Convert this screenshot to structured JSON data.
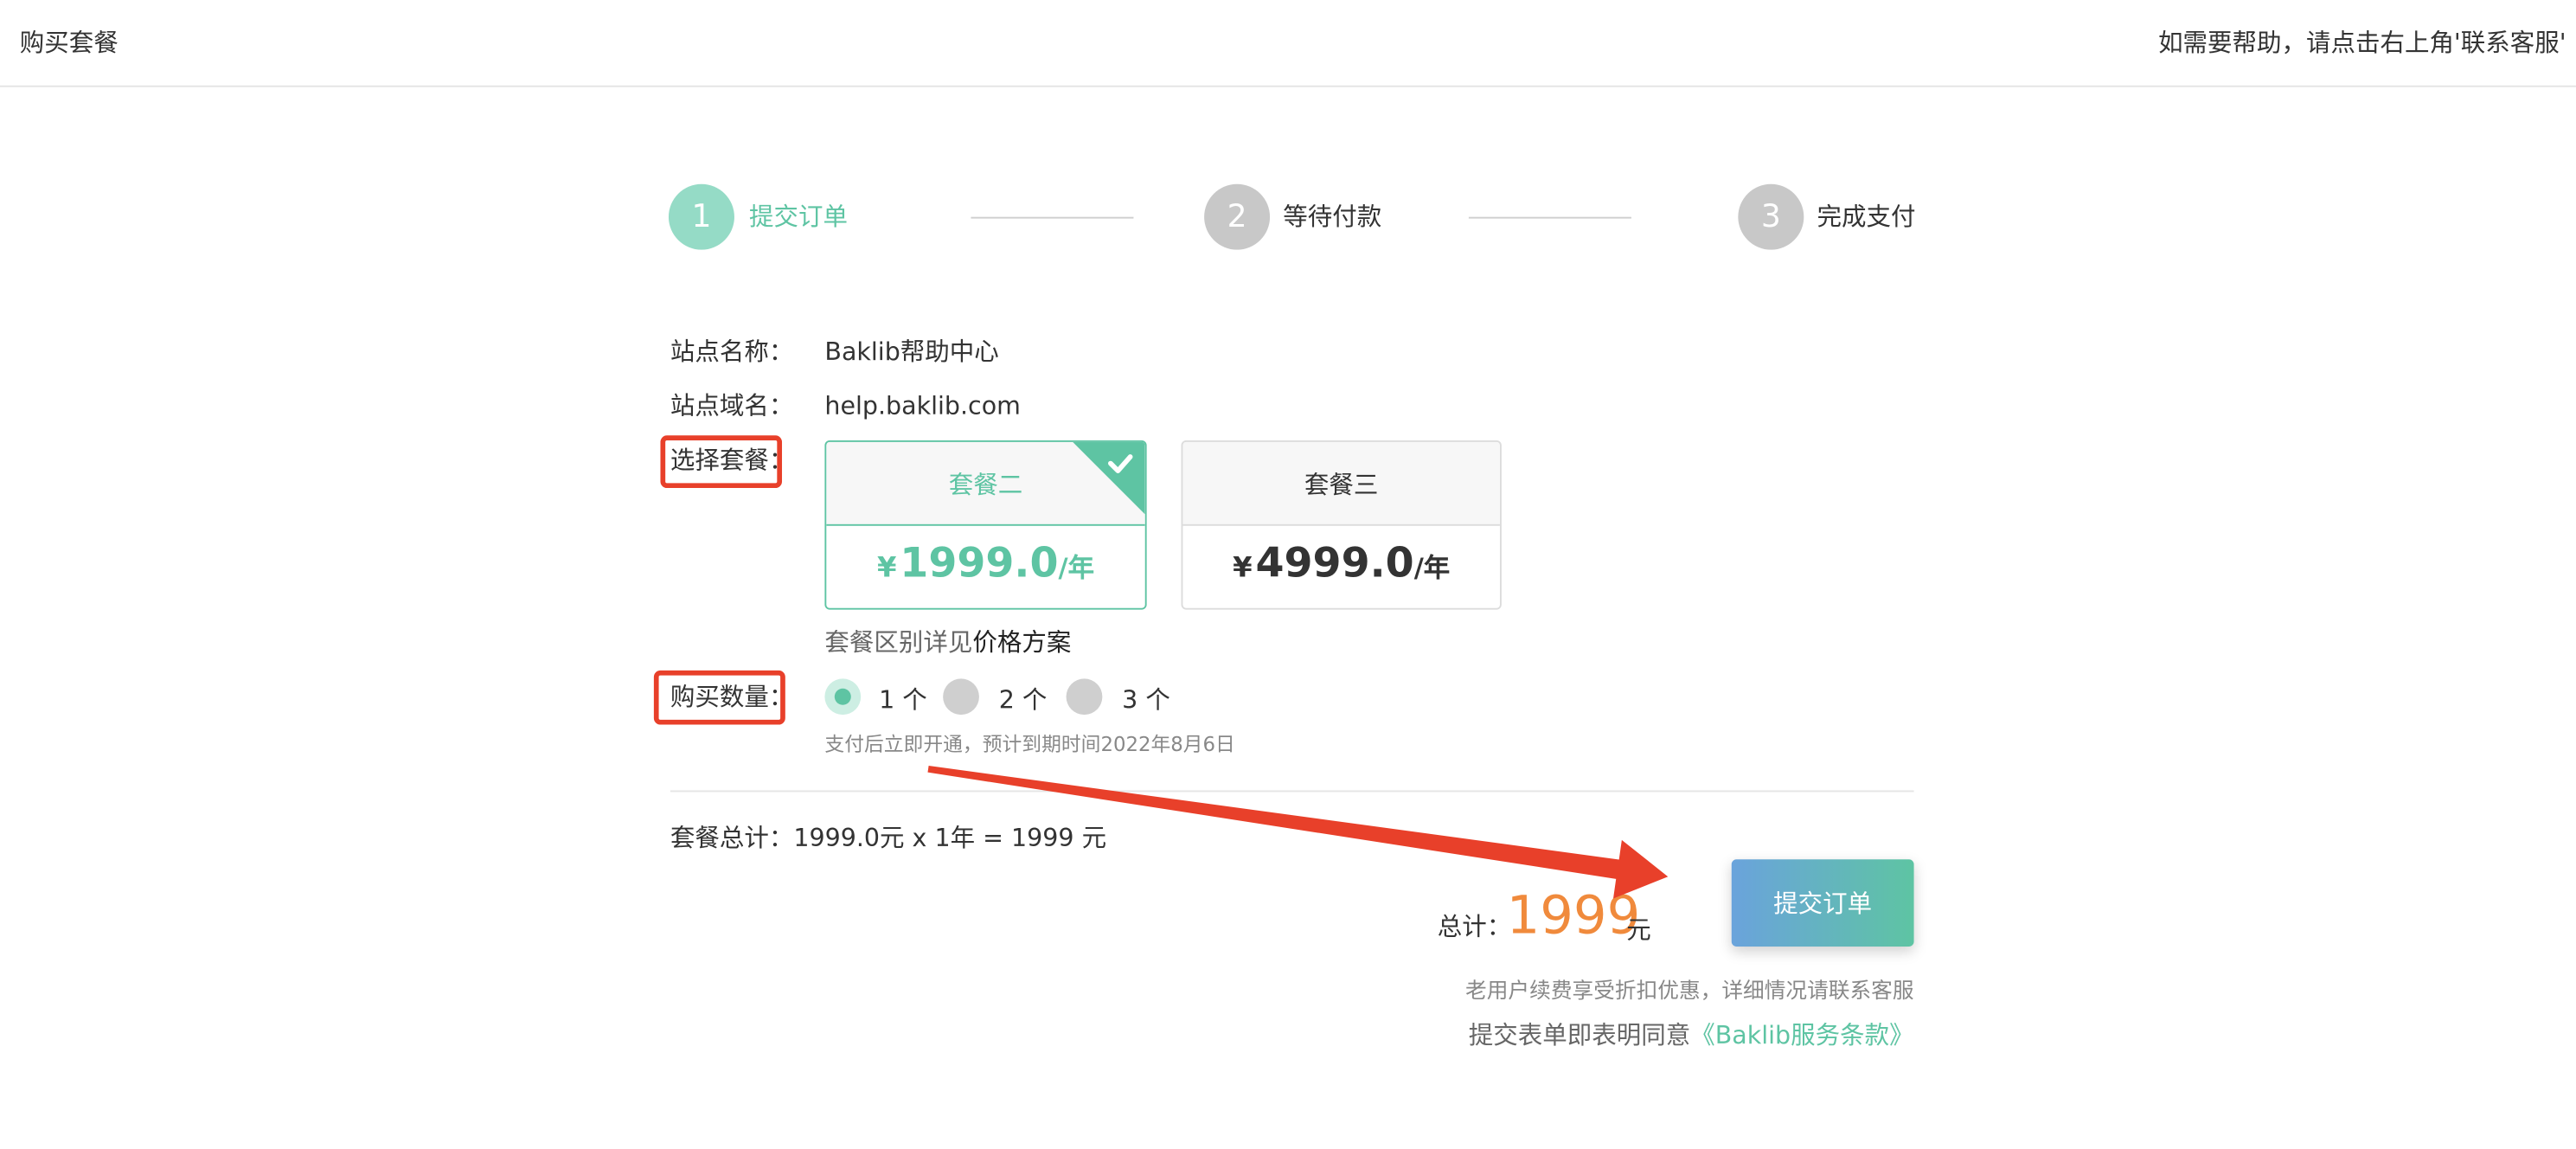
{
  "header": {
    "title": "购买套餐",
    "help_text": "如需要帮助，请点击右上角'联系客服'"
  },
  "steps": [
    {
      "number": "1",
      "label": "提交订单",
      "state": "active"
    },
    {
      "number": "2",
      "label": "等待付款",
      "state": "pending"
    },
    {
      "number": "3",
      "label": "完成支付",
      "state": "pending"
    }
  ],
  "form": {
    "site_name_label": "站点名称：",
    "site_name_value": "Baklib帮助中心",
    "site_domain_label": "站点域名：",
    "site_domain_value": "help.baklib.com",
    "plan_label": "选择套餐：",
    "plans": [
      {
        "name": "套餐二",
        "currency": "¥",
        "price": "1999.0",
        "unit": "/年",
        "selected": true
      },
      {
        "name": "套餐三",
        "currency": "¥",
        "price": "4999.0",
        "unit": "/年",
        "selected": false
      }
    ],
    "plan_note_prefix": "套餐区别详见",
    "plan_note_link": "价格方案",
    "quantity_label": "购买数量：",
    "quantity_options": [
      {
        "label": "1 个",
        "selected": true
      },
      {
        "label": "2 个",
        "selected": false
      },
      {
        "label": "3 个",
        "selected": false
      }
    ],
    "activation_note": "支付后立即开通，预计到期时间2022年8月6日"
  },
  "summary": {
    "subtotal_text": "套餐总计：1999.0元 x 1年 = 1999 元",
    "total_label": "总计：",
    "total_amount": "1999",
    "total_unit": "元",
    "submit_label": "提交订单",
    "renewal_note": "老用户续费享受折扣优惠，详细情况请联系客服",
    "agree_prefix": "提交表单即表明同意",
    "terms_link": "《Baklib服务条款》"
  },
  "icons": {
    "selected_corner": "check-icon",
    "annotation": "arrow-icon"
  },
  "colors": {
    "accent": "#5ec4a3",
    "step_active": "#95dbc6",
    "step_inactive": "#c8c8c8",
    "total_orange": "#f08a3c",
    "annotation_red": "#e8402a",
    "button_gradient_start": "#6aa3dc",
    "button_gradient_end": "#5ec4a3"
  }
}
